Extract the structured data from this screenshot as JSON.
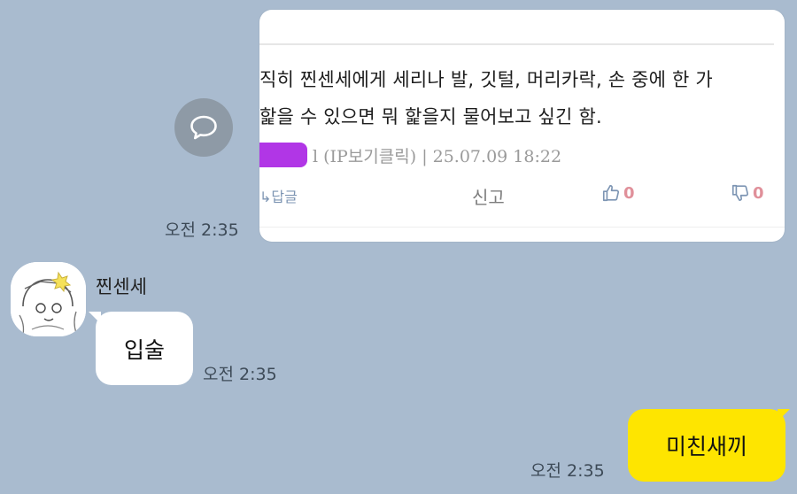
{
  "screenshot_card": {
    "line1": "직히 찐센세에게 세리나 발, 깃털, 머리카락, 손 중에 한 가",
    "line2": "핥을 수 있으면 뭐 핥을지 물어보고 싶긴 함.",
    "meta_suffix": "l (IP보기클릭) | 25.07.09 18:22",
    "reply_label": "↳답글",
    "report_label": "신고",
    "upvotes": "0",
    "downvotes": "0",
    "redaction_color": "#b136e6",
    "vote_color": "#e0909a",
    "icon_color": "#7d95b3"
  },
  "share_button": {
    "icon": "speech-bubble-icon"
  },
  "messages": [
    {
      "time": "오전 2:35"
    },
    {
      "sender": "찐센세",
      "text": "입술",
      "time": "오전 2:35"
    },
    {
      "text": "미친새끼",
      "time": "오전 2:35"
    }
  ],
  "colors": {
    "background": "#a9bbcf",
    "outgoing_bubble": "#fee500",
    "incoming_bubble": "#ffffff"
  }
}
